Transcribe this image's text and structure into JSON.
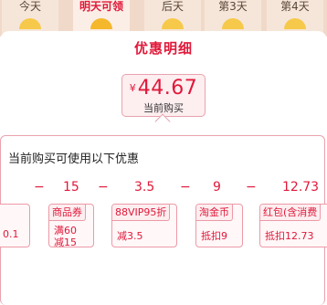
{
  "days": [
    "今天",
    "明天可领",
    "后天",
    "第3天",
    "第4天"
  ],
  "sheet": {
    "title": "优惠明细",
    "price": {
      "currency": "¥",
      "value": "44.67",
      "caption": "当前购买"
    }
  },
  "discounts": {
    "heading": "当前购买可使用以下优惠",
    "calc": [
      "−",
      "15",
      "−",
      "3.5",
      "−",
      "9",
      "−",
      "12.73"
    ],
    "cards": [
      {
        "tag": "",
        "lines": [
          "0.1"
        ]
      },
      {
        "tag": "商品券",
        "lines": [
          "满60",
          "减15"
        ]
      },
      {
        "tag": "88VIP95折",
        "lines": [
          "减3.5"
        ]
      },
      {
        "tag": "淘金币",
        "lines": [
          "抵扣9"
        ]
      },
      {
        "tag": "红包(含消费",
        "lines": [
          "抵扣12.73"
        ]
      }
    ]
  },
  "colors": {
    "accent": "#e0193a",
    "border": "#e8a2ad",
    "coin": "#f7c94b"
  }
}
